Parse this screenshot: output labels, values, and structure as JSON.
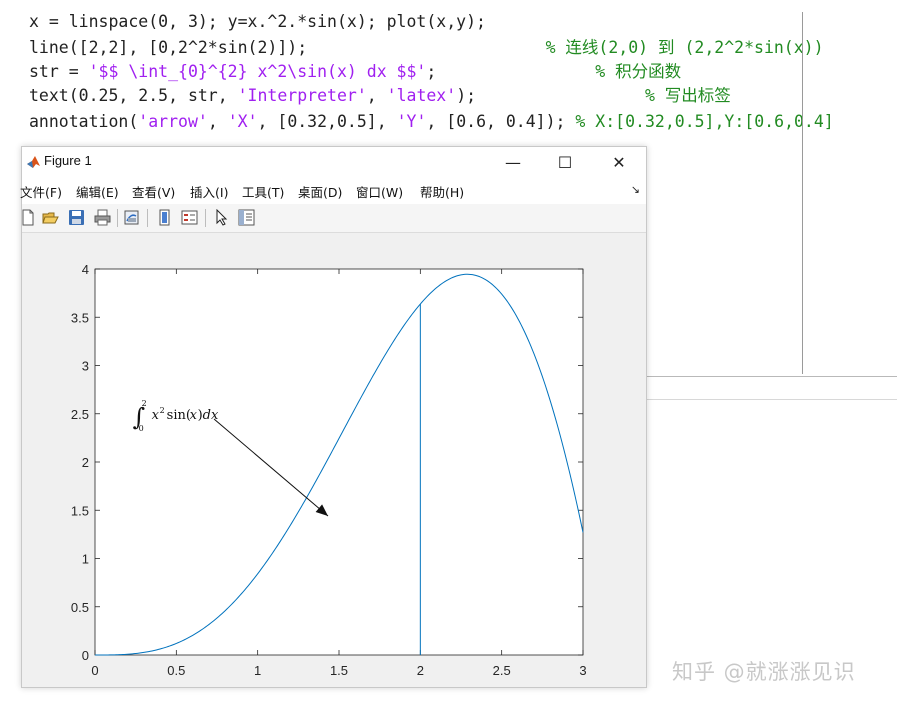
{
  "code": {
    "lines": [
      {
        "parts": [
          {
            "t": "x = linspace(0, 3); y=x.^2.*sin(x); plot(x,y);",
            "c": "plain"
          }
        ]
      },
      {
        "parts": [
          {
            "t": "line([2,2], [0,2^2*sin(2)]);                        ",
            "c": "plain"
          },
          {
            "t": "% 连线(2,0) 到 (2,2^2*sin(x))",
            "c": "cmt"
          }
        ]
      },
      {
        "parts": [
          {
            "t": "str = ",
            "c": "plain"
          },
          {
            "t": "'$$ \\int_{0}^{2} x^2\\sin(x) dx $$'",
            "c": "str"
          },
          {
            "t": ";                ",
            "c": "plain"
          },
          {
            "t": "% 积分函数",
            "c": "cmt"
          }
        ]
      },
      {
        "parts": [
          {
            "t": "text(0.25, 2.5, str, ",
            "c": "plain"
          },
          {
            "t": "'Interpreter'",
            "c": "str"
          },
          {
            "t": ", ",
            "c": "plain"
          },
          {
            "t": "'latex'",
            "c": "str"
          },
          {
            "t": ");                 ",
            "c": "plain"
          },
          {
            "t": "% 写出标签",
            "c": "cmt"
          }
        ]
      },
      {
        "parts": [
          {
            "t": "annotation(",
            "c": "plain"
          },
          {
            "t": "'arrow'",
            "c": "str"
          },
          {
            "t": ", ",
            "c": "plain"
          },
          {
            "t": "'X'",
            "c": "str"
          },
          {
            "t": ", [0.32,0.5], ",
            "c": "plain"
          },
          {
            "t": "'Y'",
            "c": "str"
          },
          {
            "t": ", [0.6, 0.4]); ",
            "c": "plain"
          },
          {
            "t": "% X:[0.32,0.5],Y:[0.6,0.4]",
            "c": "cmt"
          }
        ]
      }
    ]
  },
  "figure": {
    "title": "Figure 1",
    "buttons": {
      "minimize": "—",
      "maximize": "☐",
      "close": "✕"
    },
    "menu": [
      "文件(F)",
      "编辑(E)",
      "查看(V)",
      "插入(I)",
      "工具(T)",
      "桌面(D)",
      "窗口(W)",
      "帮助(H)"
    ],
    "menu_arrow": "↘",
    "toolbar_icons": [
      "new-figure-icon",
      "open-file-icon",
      "save-icon",
      "print-icon",
      "link-plot-icon",
      "insert-colorbar-icon",
      "insert-legend-icon",
      "edit-plot-icon",
      "property-inspector-icon"
    ]
  },
  "chart_data": {
    "type": "line",
    "function": "y = x^2 * sin(x)",
    "x_range": [
      0,
      3
    ],
    "xlim": [
      0,
      3
    ],
    "ylim": [
      0,
      4
    ],
    "xticks": [
      "0",
      "0.5",
      "1",
      "1.5",
      "2",
      "2.5",
      "3"
    ],
    "yticks": [
      "0",
      "0.5",
      "1",
      "1.5",
      "2",
      "2.5",
      "3",
      "3.5",
      "4"
    ],
    "series": [
      {
        "x": [
          0,
          0.25,
          0.5,
          0.75,
          1,
          1.25,
          1.5,
          1.75,
          2,
          2.25,
          2.5,
          2.75,
          3
        ],
        "y": [
          0,
          0.015,
          0.12,
          0.383,
          0.841,
          1.481,
          2.244,
          3.015,
          3.637,
          3.937,
          3.74,
          2.887,
          1.27
        ]
      }
    ],
    "vertical_line": {
      "x": 2,
      "y_from": 0,
      "y_to": 3.637
    },
    "annotation_text": "∫₀² x² sin(x)dx",
    "annotation_text_pos": [
      0.25,
      2.5
    ],
    "arrow": {
      "from_frac": [
        0.32,
        0.6
      ],
      "to_frac": [
        0.5,
        0.4
      ]
    },
    "line_color": "#0072bd",
    "grid": false
  },
  "watermark": "知乎 @就涨涨见识"
}
